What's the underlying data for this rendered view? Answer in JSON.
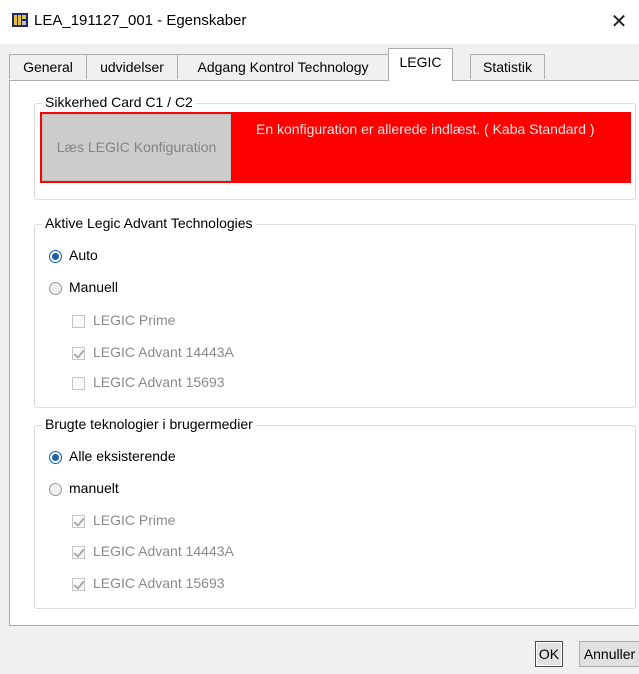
{
  "window": {
    "title": "LEA_191127_001 - Egenskaber",
    "close_glyph": "✕"
  },
  "tabs": [
    {
      "label": "General"
    },
    {
      "label": "udvidelser"
    },
    {
      "label": "Adgang Kontrol Technology"
    },
    {
      "label": "LEGIC",
      "active": true
    },
    {
      "label": "Statistik"
    }
  ],
  "security": {
    "group_label": "Sikkerhed Card C1 / C2",
    "read_button_label": "Læs LEGIC Konfiguration",
    "status_text": "En konfiguration er allerede indlæst. ( Kaba Standard )",
    "status_color": "#ff0000"
  },
  "active_tech": {
    "group_label": "Aktive Legic Advant Technologies",
    "options": [
      {
        "label": "Auto",
        "selected": true
      },
      {
        "label": "Manuell",
        "selected": false
      }
    ],
    "checks": [
      {
        "label": "LEGIC Prime",
        "checked": false
      },
      {
        "label": "LEGIC Advant 14443A",
        "checked": true
      },
      {
        "label": "LEGIC Advant 15693",
        "checked": false
      }
    ]
  },
  "used_tech": {
    "group_label": "Brugte teknologier i brugermedier",
    "options": [
      {
        "label": "Alle eksisterende",
        "selected": true
      },
      {
        "label": "manuelt",
        "selected": false
      }
    ],
    "checks": [
      {
        "label": "LEGIC Prime",
        "checked": true
      },
      {
        "label": "LEGIC Advant 14443A",
        "checked": true
      },
      {
        "label": "LEGIC Advant 15693",
        "checked": true
      }
    ]
  },
  "buttons": {
    "ok": "OK",
    "cancel": "Annuller"
  }
}
